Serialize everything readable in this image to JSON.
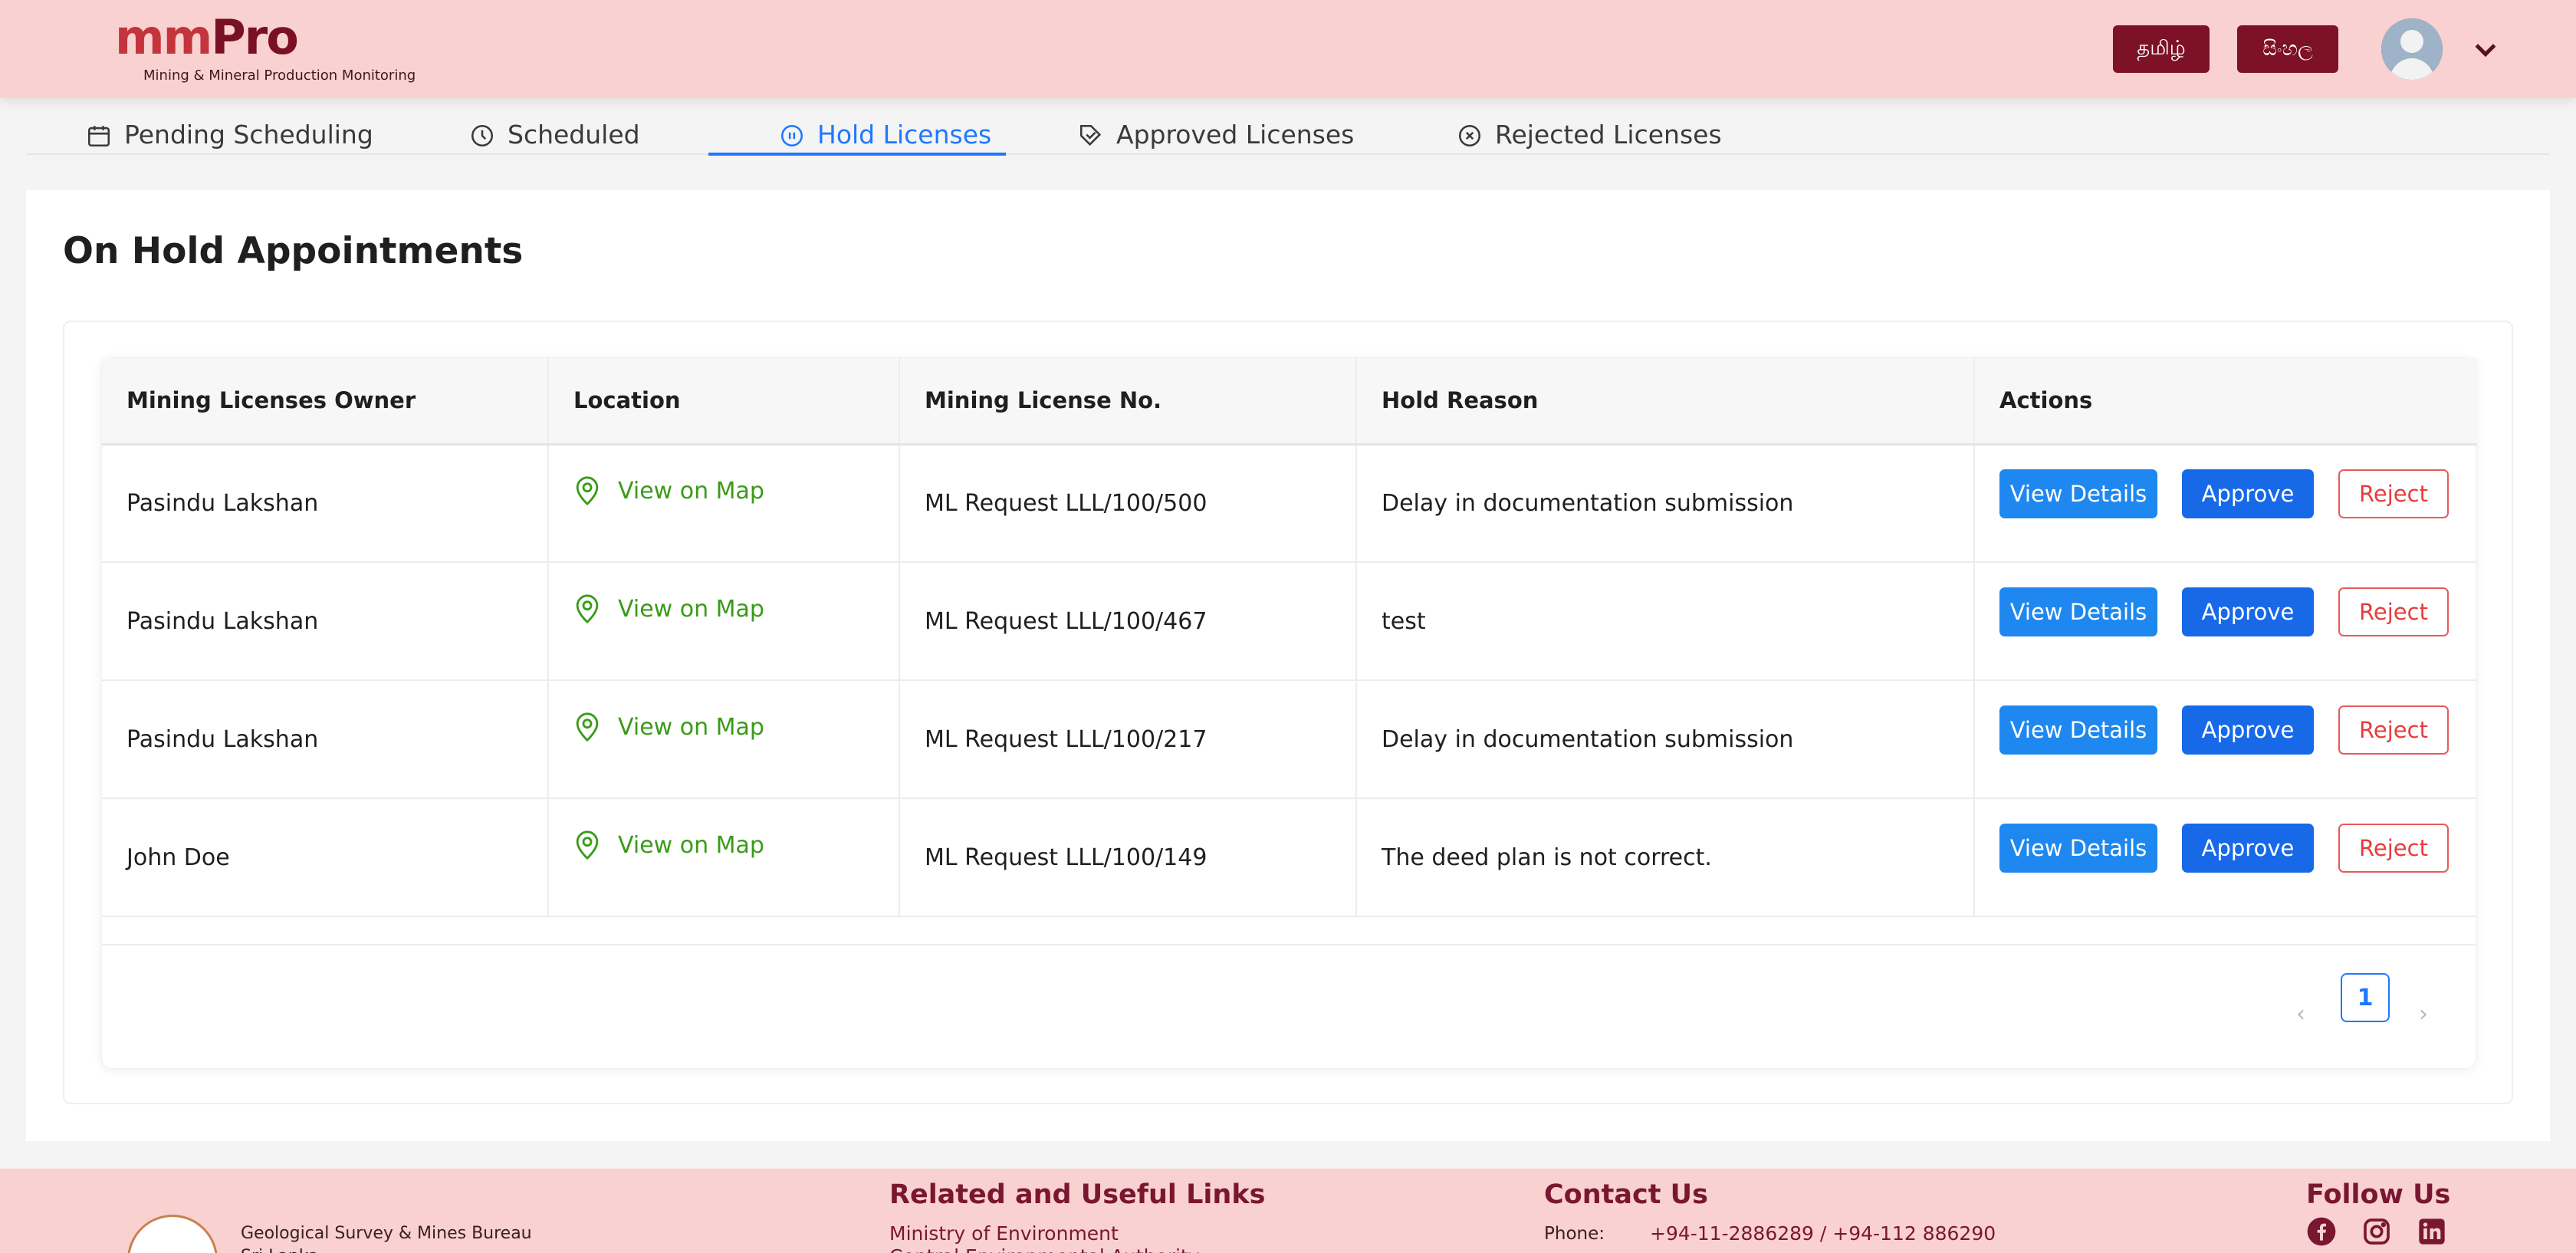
{
  "header": {
    "logo_main": "mm",
    "logo_accent": "Pro",
    "logo_subtitle": "Mining & Mineral Production Monitoring",
    "lang_tamil": "தமிழ்",
    "lang_sinhala": "සිංහල"
  },
  "tabs": [
    {
      "label": "Pending Scheduling",
      "icon": "calendar-icon",
      "active": false
    },
    {
      "label": "Scheduled",
      "icon": "clock-icon",
      "active": false
    },
    {
      "label": "Hold Licenses",
      "icon": "pause-circle-icon",
      "active": true
    },
    {
      "label": "Approved Licenses",
      "icon": "check-tag-icon",
      "active": false
    },
    {
      "label": "Rejected Licenses",
      "icon": "x-circle-icon",
      "active": false
    }
  ],
  "main": {
    "title": "On Hold Appointments",
    "columns": [
      "Mining Licenses Owner",
      "Location",
      "Mining License No.",
      "Hold Reason",
      "Actions"
    ],
    "rows": [
      {
        "owner": "Pasindu Lakshan",
        "location": "View on Map",
        "license": "ML Request LLL/100/500",
        "reason": "Delay in documentation submission"
      },
      {
        "owner": "Pasindu Lakshan",
        "location": "View on Map",
        "license": "ML Request LLL/100/467",
        "reason": "test"
      },
      {
        "owner": "Pasindu Lakshan",
        "location": "View on Map",
        "license": "ML Request LLL/100/217",
        "reason": "Delay in documentation submission"
      },
      {
        "owner": "John Doe",
        "location": "View on Map",
        "license": "ML Request LLL/100/149",
        "reason": "The deed plan is not correct."
      }
    ],
    "actions": {
      "view": "View Details",
      "approve": "Approve",
      "reject": "Reject"
    },
    "pagination": {
      "prev": "‹",
      "current": "1",
      "next": "›"
    }
  },
  "footer": {
    "org_name": "Geological Survey & Mines Bureau",
    "org_line2": "Sri Lanka",
    "links_title": "Related and Useful Links",
    "link_1": "Ministry of Environment",
    "link_2": "Central Environmental Authority",
    "contact_title": "Contact Us",
    "phone_label": "Phone:",
    "phone_value": "+94-11-2886289 / +94-112 886290",
    "follow_title": "Follow Us",
    "social_icons": [
      "facebook-icon",
      "instagram-icon",
      "linkedin-icon"
    ]
  },
  "colors": {
    "header_bg": "#f9d1d1",
    "brand_dark": "#7d1126",
    "accent_blue": "#1f78ff",
    "link_green": "#3a9b19",
    "reject_red": "#e83b3b"
  }
}
